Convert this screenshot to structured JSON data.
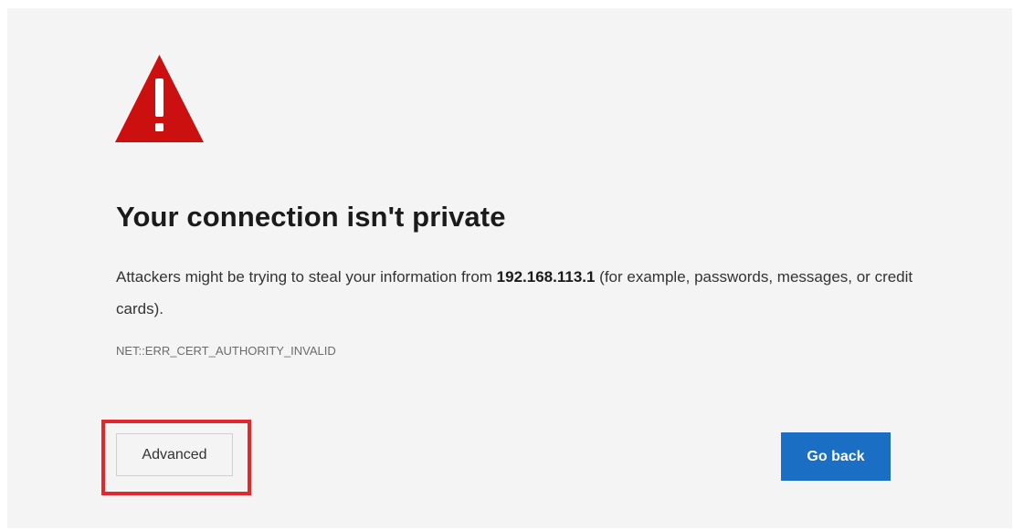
{
  "colors": {
    "background": "#f4f4f4",
    "warning_red": "#cc1010",
    "primary_blue": "#1a6fc4",
    "highlight_red": "#e0282f"
  },
  "icons": {
    "warning": "warning-triangle-icon"
  },
  "title": "Your connection isn't private",
  "description": {
    "before_host": "Attackers might be trying to steal your information from ",
    "host": "192.168.113.1",
    "after_host": " (for example, passwords, messages, or credit cards)."
  },
  "error_code": "NET::ERR_CERT_AUTHORITY_INVALID",
  "buttons": {
    "advanced": "Advanced",
    "go_back": "Go back"
  }
}
